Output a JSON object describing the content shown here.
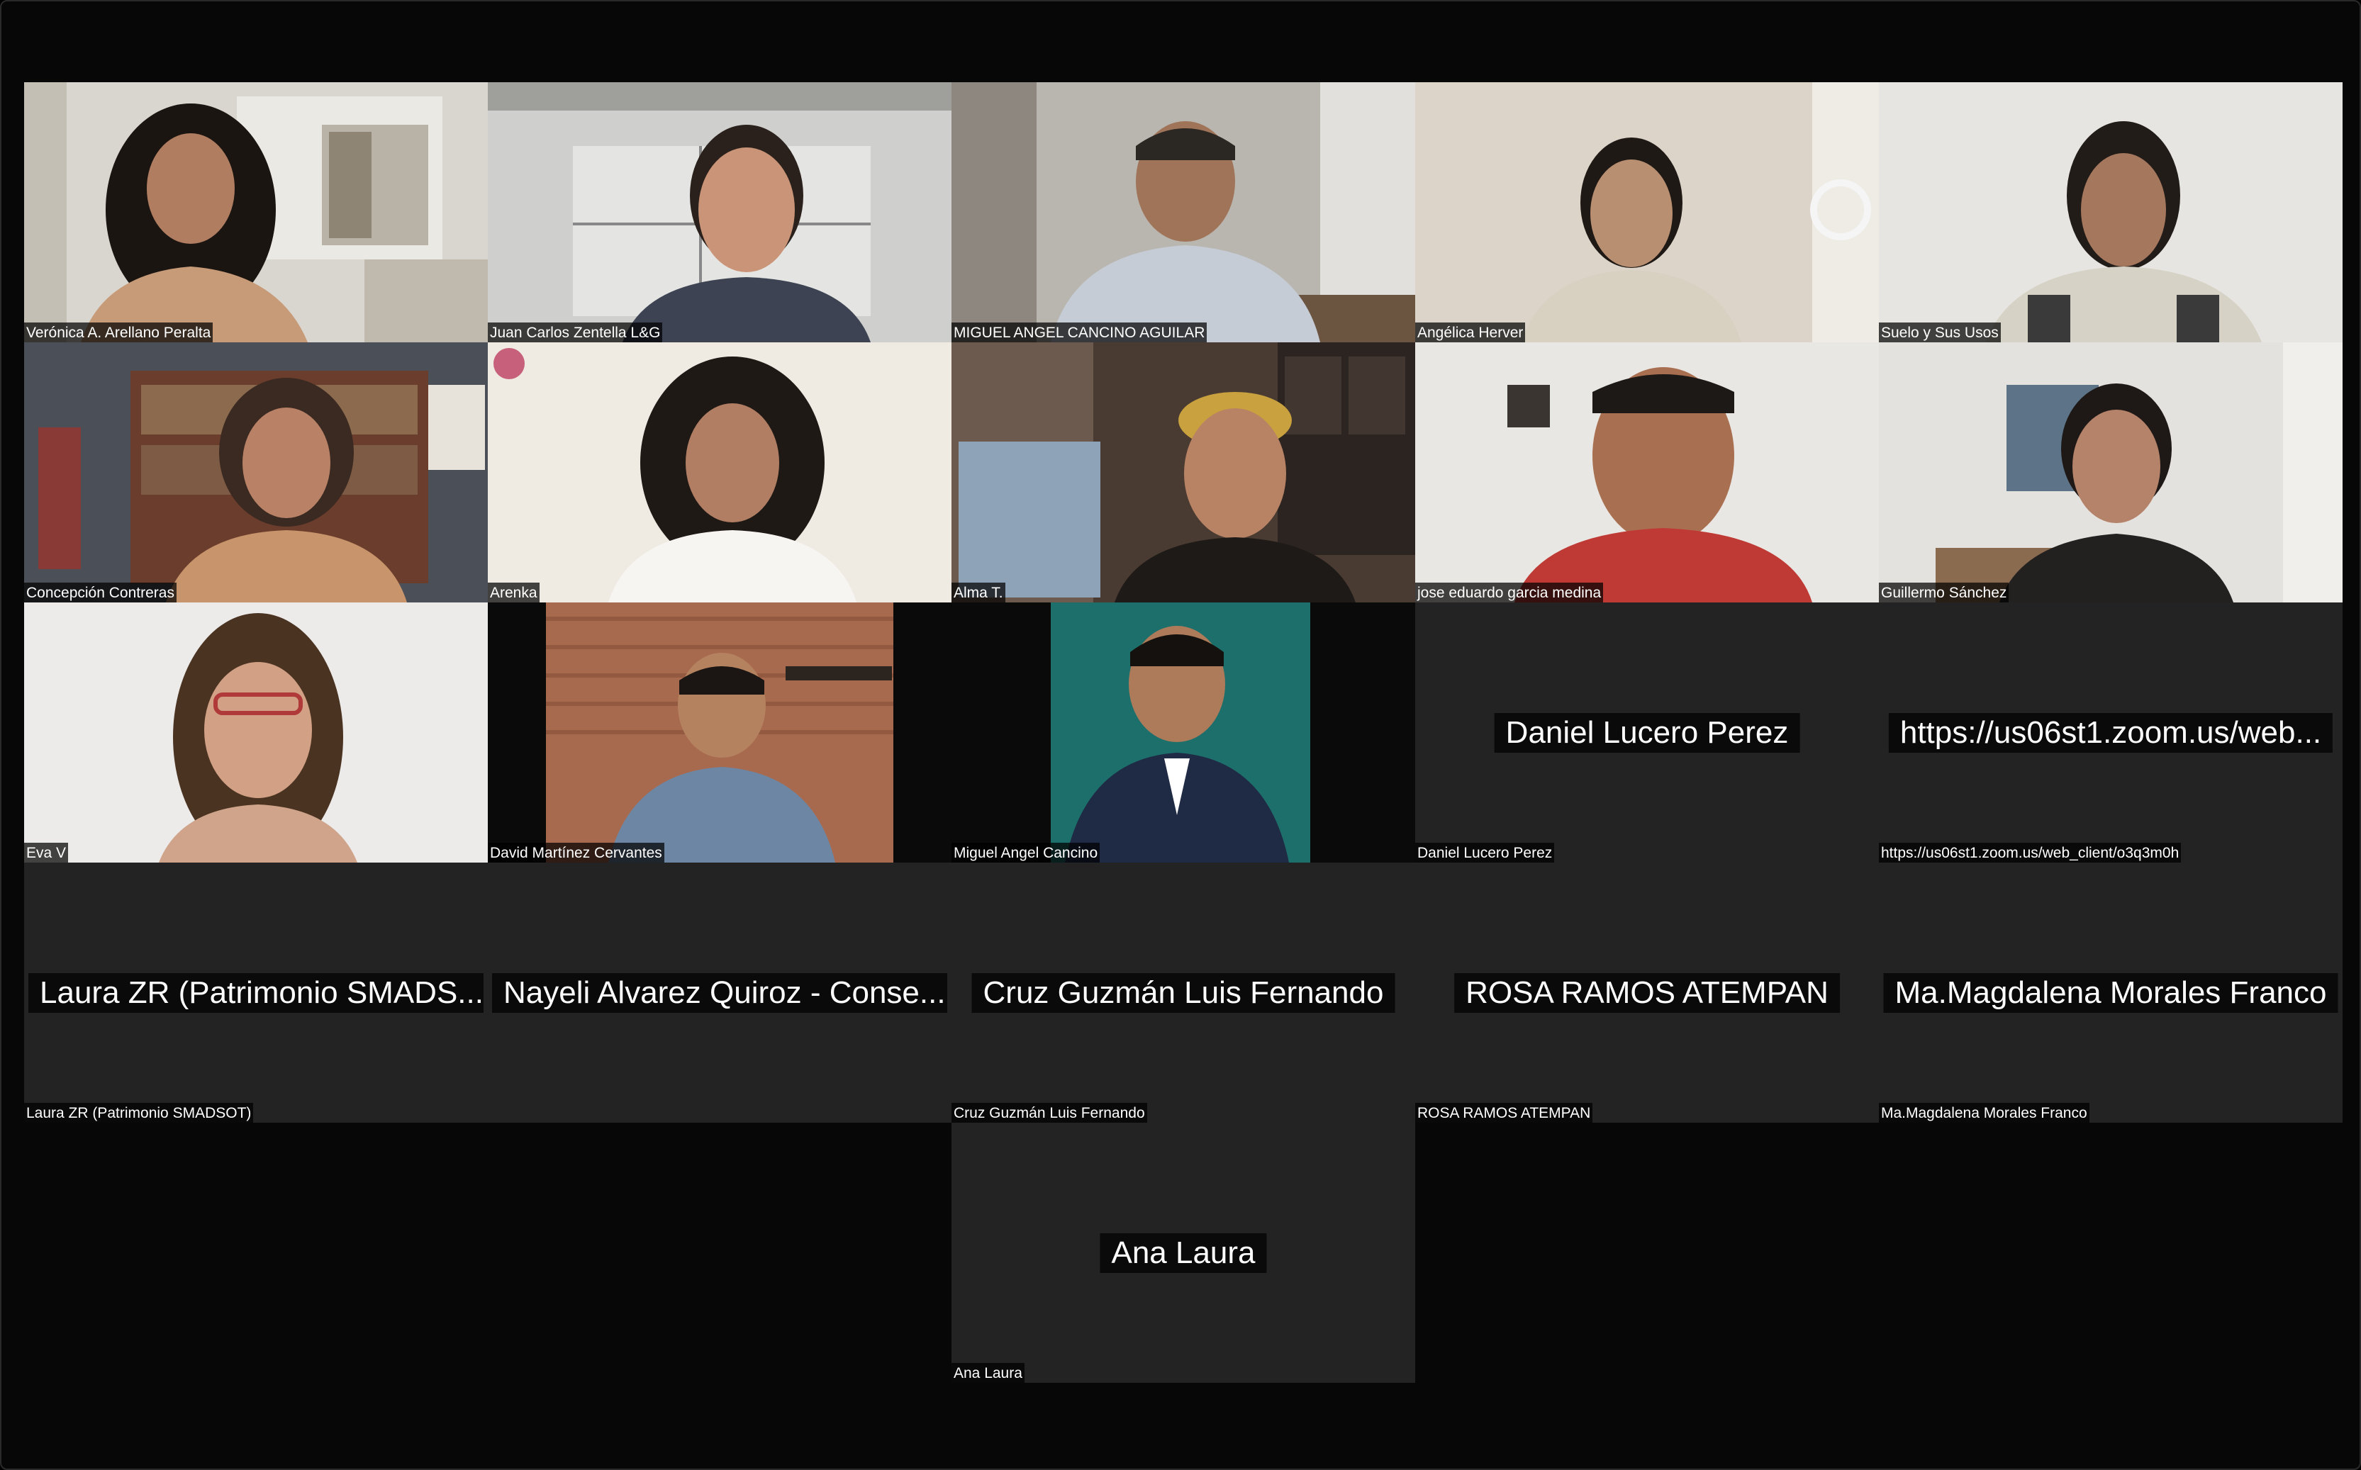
{
  "window": {
    "app": "Zoom gallery view"
  },
  "participants": [
    {
      "name": "Verónica A. Arellano Peralta",
      "video": true
    },
    {
      "name": "Juan Carlos Zentella L&G",
      "video": true
    },
    {
      "name": "MIGUEL ANGEL CANCINO AGUILAR",
      "video": true
    },
    {
      "name": "Angélica Herver",
      "video": true
    },
    {
      "name": "Suelo y Sus Usos",
      "video": true
    },
    {
      "name": "Concepción Contreras",
      "video": true
    },
    {
      "name": "Arenka",
      "video": true
    },
    {
      "name": "Alma T.",
      "video": true
    },
    {
      "name": "jose eduardo garcia medina",
      "video": true
    },
    {
      "name": "Guillermo Sánchez",
      "video": true
    },
    {
      "name": "Eva V",
      "video": true
    },
    {
      "name": "David Martínez Cervantes",
      "video": true
    },
    {
      "name": "Miguel Angel Cancino",
      "video": true
    },
    {
      "name": "Daniel Lucero Perez",
      "video": false,
      "display": "Daniel Lucero Perez"
    },
    {
      "name": "https://us06st1.zoom.us/web_client/o3q3m0h",
      "video": false,
      "display": "https://us06st1.zoom.us/web..."
    },
    {
      "name": "Laura ZR (Patrimonio SMADSOT)",
      "video": false,
      "display": "Laura ZR (Patrimonio SMADS..."
    },
    {
      "name": "",
      "video": false,
      "display": "Nayeli Alvarez Quiroz - Conse..."
    },
    {
      "name": "Cruz Guzmán Luis Fernando",
      "video": false,
      "display": "Cruz Guzmán Luis Fernando"
    },
    {
      "name": "ROSA RAMOS ATEMPAN",
      "video": false,
      "display": "ROSA RAMOS ATEMPAN"
    },
    {
      "name": "Ma.Magdalena Morales Franco",
      "video": false,
      "display": "Ma.Magdalena Morales Franco"
    },
    {
      "name": "Ana Laura",
      "video": false,
      "display": "Ana Laura"
    }
  ],
  "colors": {
    "background": "#070707",
    "tile_off": "#232323",
    "name_tag_bg": "#000000"
  }
}
